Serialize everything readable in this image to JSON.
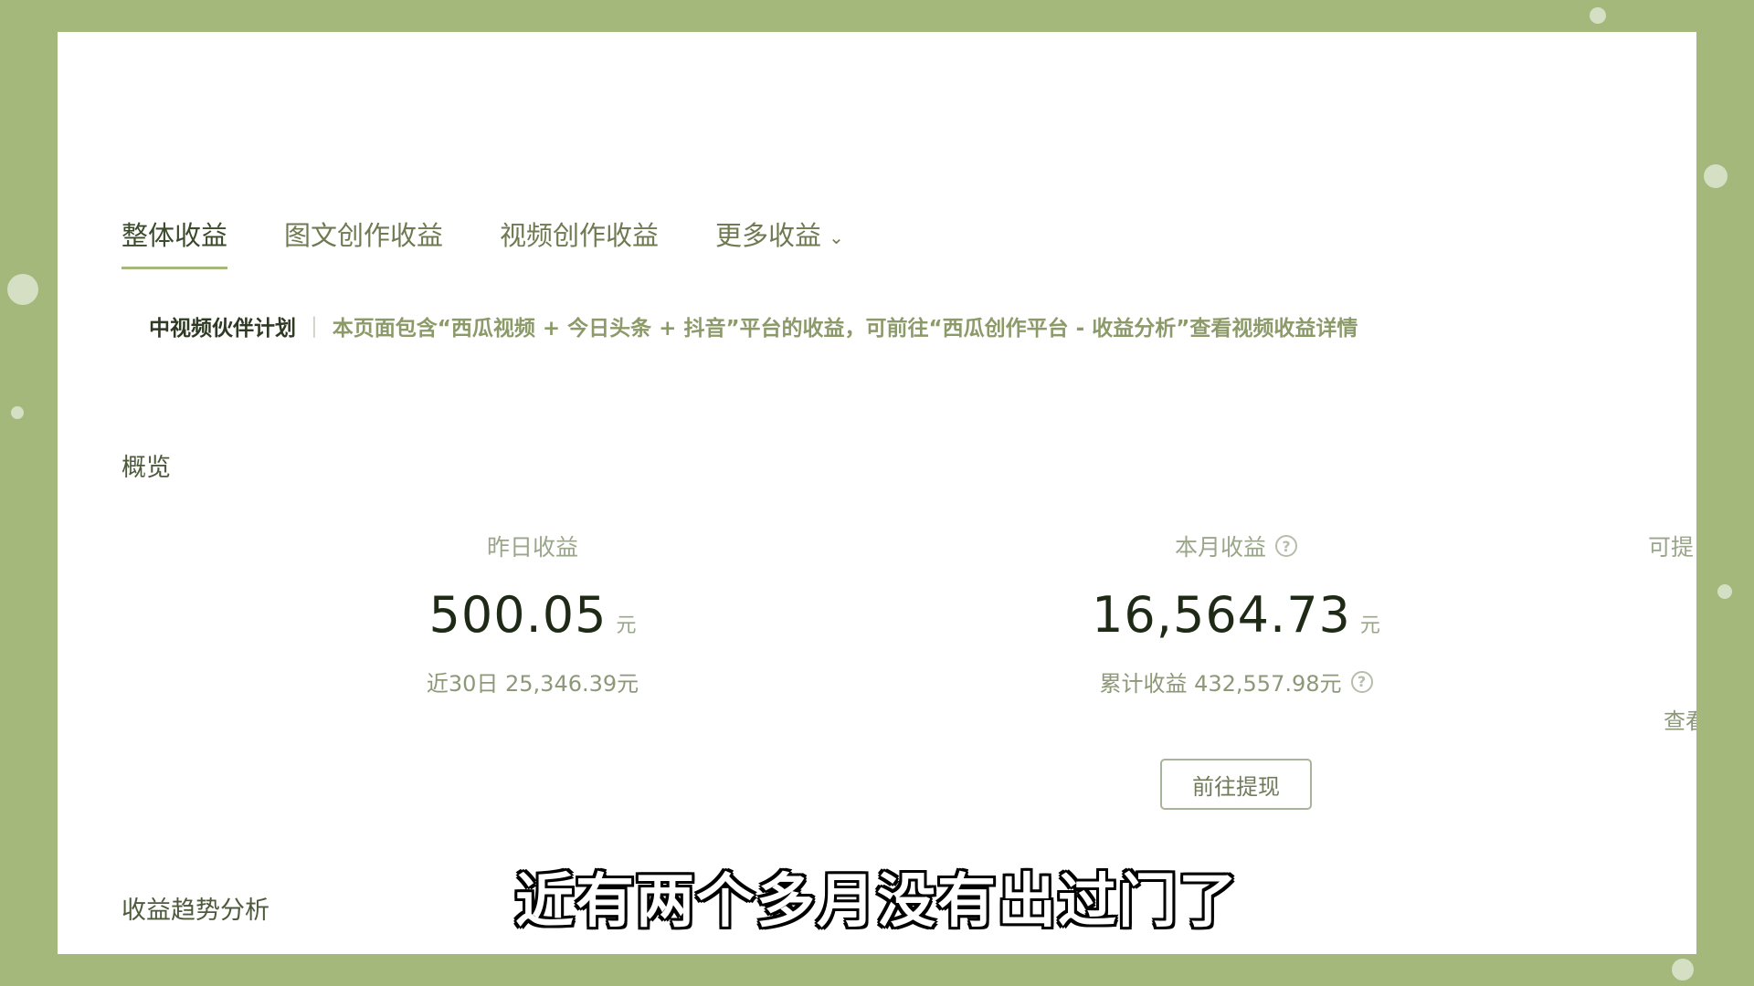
{
  "tabs": [
    {
      "label": "整体收益",
      "active": true
    },
    {
      "label": "图文创作收益",
      "active": false
    },
    {
      "label": "视频创作收益",
      "active": false
    },
    {
      "label": "更多收益",
      "active": false,
      "has_dropdown": true
    }
  ],
  "notice": {
    "plan_label": "中视频伙伴计划",
    "separator": "|",
    "text": "本页面包含“西瓜视频 + 今日头条 + 抖音”平台的收益，可前往“西瓜创作平台 - 收益分析”查看视频收益详情"
  },
  "overview": {
    "title": "概览",
    "yesterday": {
      "label": "昨日收益",
      "value": "500.05",
      "unit": "元",
      "sub": "近30日 25,346.39元"
    },
    "month": {
      "label": "本月收益",
      "value": "16,564.73",
      "unit": "元",
      "sub": "累计收益 432,557.98元",
      "button": "前往提现"
    },
    "third": {
      "label": "可提",
      "sub": "查看"
    }
  },
  "trend": {
    "title": "收益趋势分析"
  },
  "subtitle": "近有两个多月没有出过门了",
  "colors": {
    "background": "#a3b87a",
    "panel": "#ffffff",
    "accent": "#a3b87a"
  }
}
